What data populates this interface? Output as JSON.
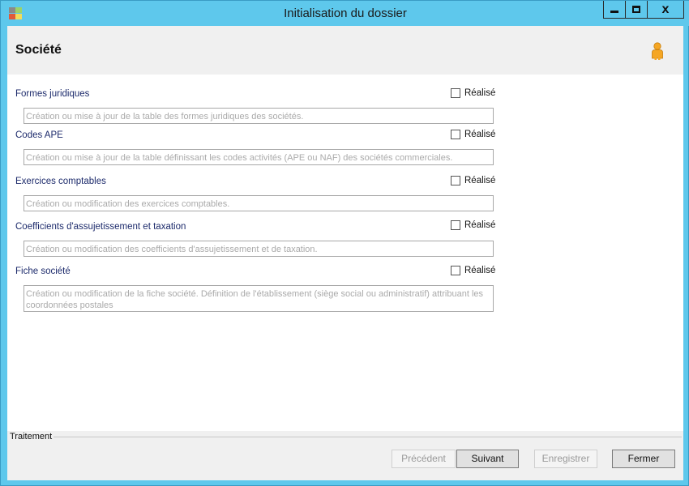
{
  "window": {
    "title": "Initialisation du dossier",
    "close_glyph": "x"
  },
  "header": {
    "title": "Société",
    "user_icon": "user-icon"
  },
  "sections": [
    {
      "label": "Formes juridiques",
      "check_label": "Réalisé",
      "checked": false,
      "description": "Création ou mise à jour de la table des formes juridiques des sociétés."
    },
    {
      "label": "Codes APE",
      "check_label": "Réalisé",
      "checked": false,
      "description": "Création ou mise à jour de la table définissant les codes activités (APE ou NAF) des sociétés commerciales."
    },
    {
      "label": "Exercices comptables",
      "check_label": "Réalisé",
      "checked": false,
      "description": "Création ou modification des exercices comptables."
    },
    {
      "label": "Coefficients d'assujetissement et taxation",
      "check_label": "Réalisé",
      "checked": false,
      "description": "Création ou modification des coefficients d'assujetissement et de taxation."
    },
    {
      "label": "Fiche société",
      "check_label": "Réalisé",
      "checked": false,
      "description": "Création ou modification de la fiche société. Définition de l'établissement (siège social ou administratif) attribuant les coordonnées postales"
    }
  ],
  "footer": {
    "group_label": "Traitement",
    "buttons": {
      "previous": "Précédent",
      "next": "Suivant",
      "save": "Enregistrer",
      "close": "Fermer"
    }
  },
  "colors": {
    "titlebar": "#5ec8ec",
    "section_label": "#1c2a6b",
    "description_text": "#aaaaaa"
  }
}
